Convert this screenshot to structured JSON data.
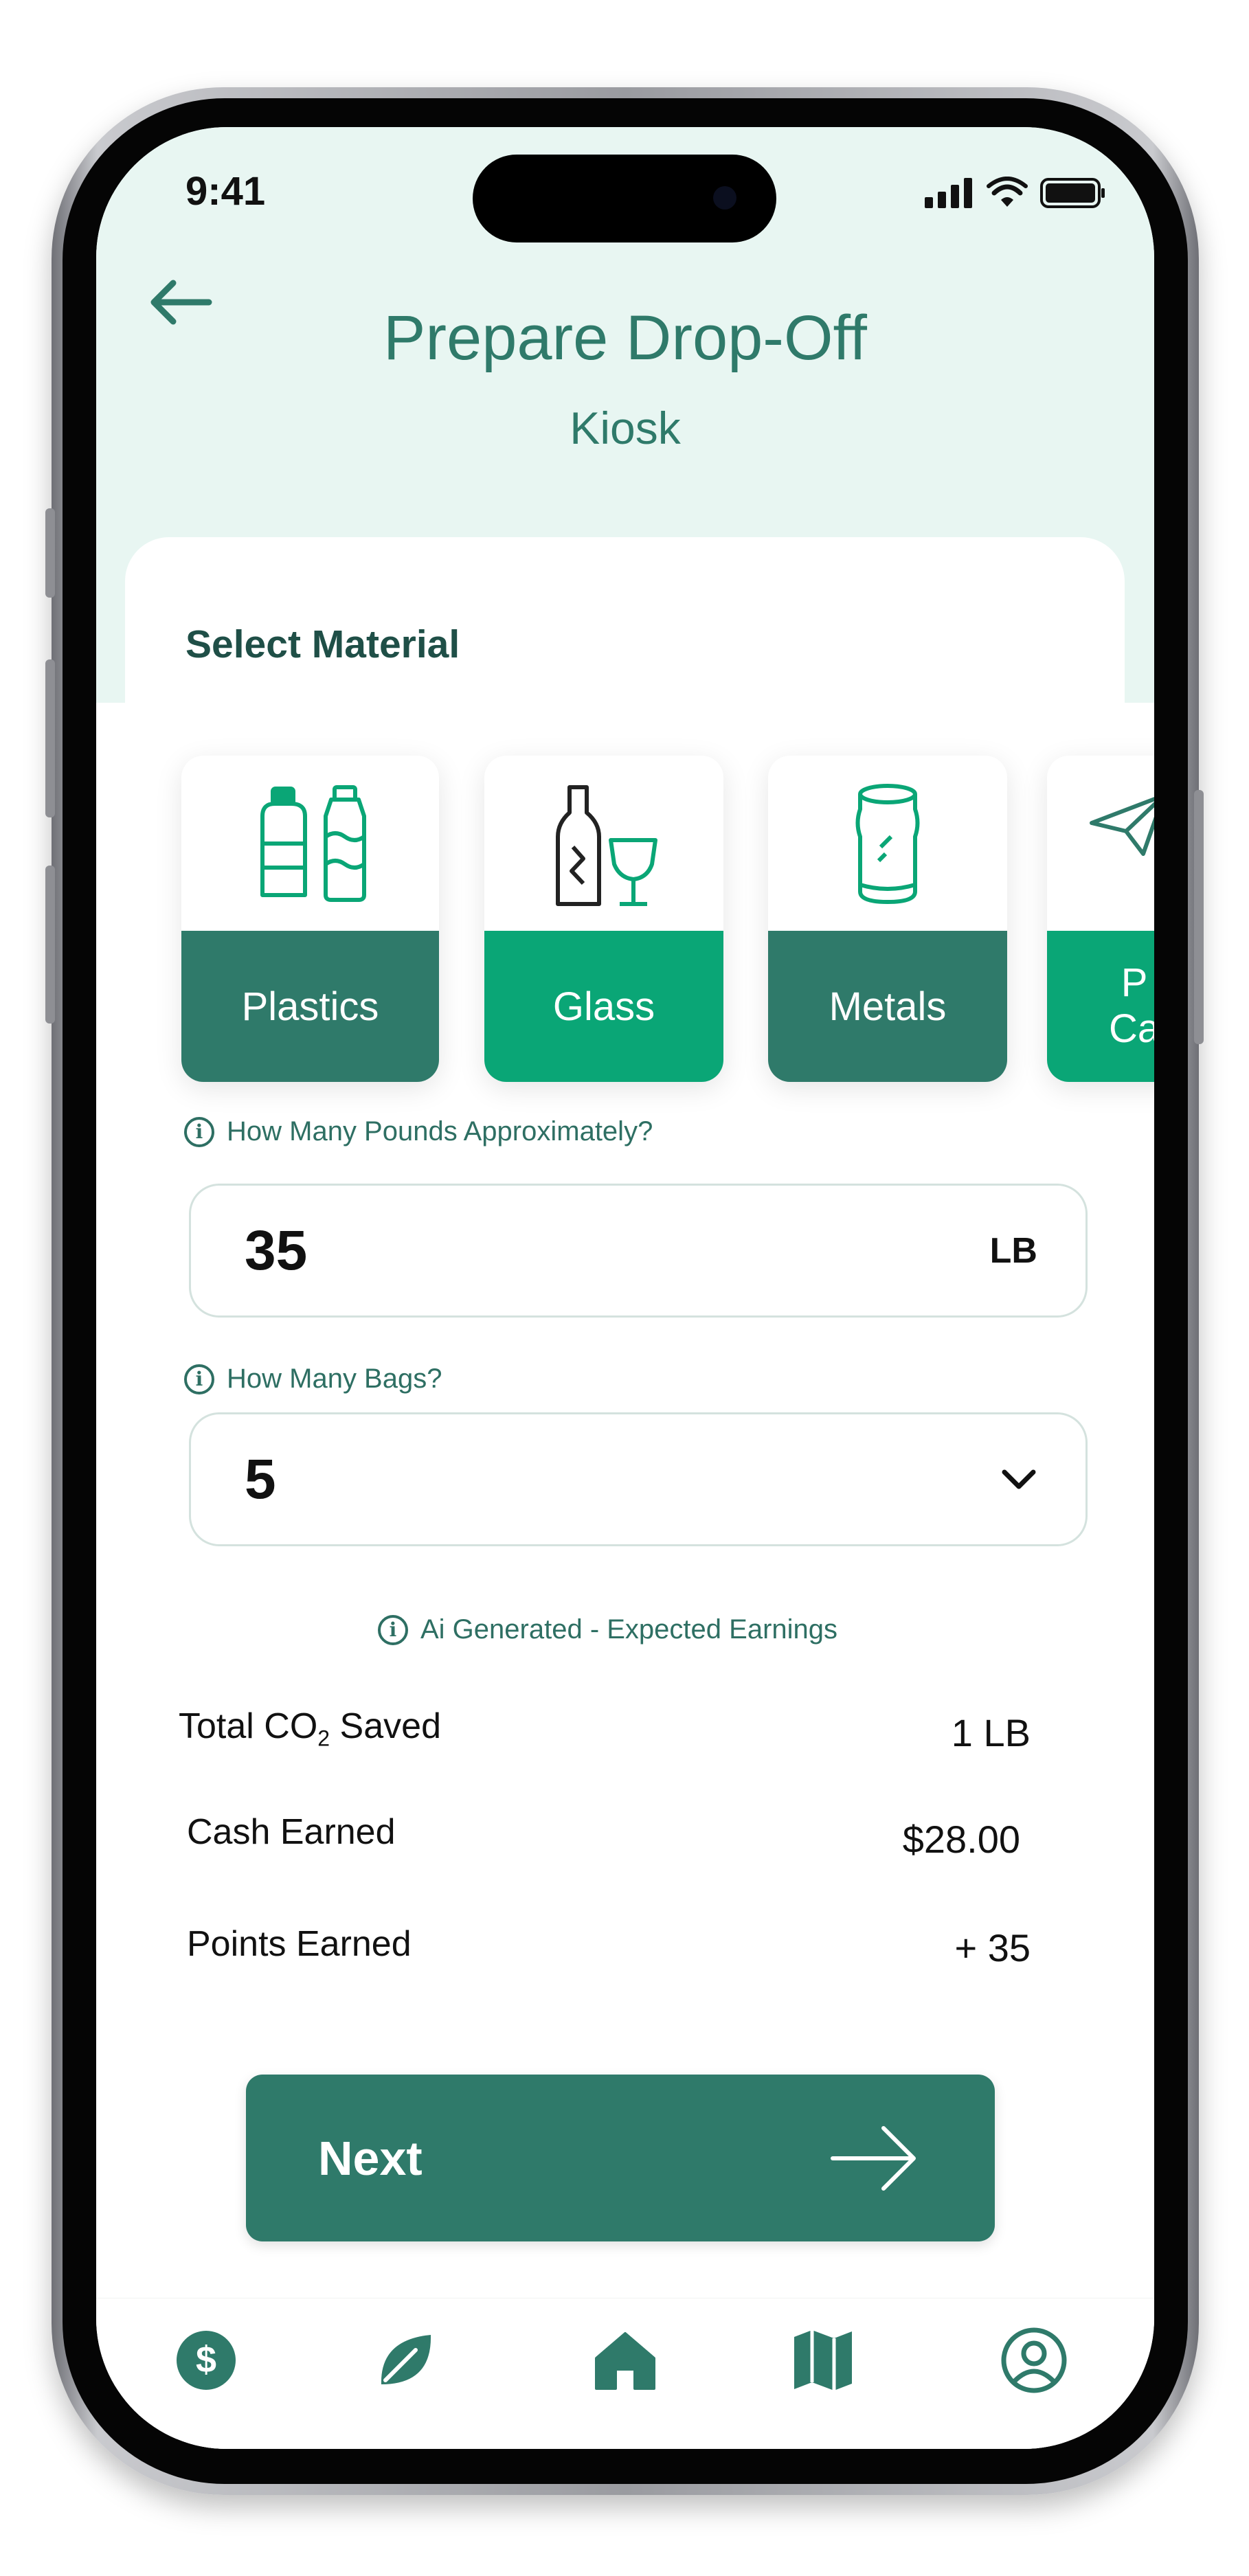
{
  "status_bar": {
    "time": "9:41"
  },
  "header": {
    "title": "Prepare Drop-Off",
    "subtitle": "Kiosk"
  },
  "section": {
    "label": "Select Material"
  },
  "materials": [
    {
      "label": "Plastics",
      "selected": true
    },
    {
      "label": "Glass",
      "selected": false
    },
    {
      "label": "Metals",
      "selected": false
    },
    {
      "label": "P\nCa",
      "selected": false
    }
  ],
  "pounds": {
    "hint": "How Many Pounds Approximately?",
    "value": "35",
    "unit": "LB"
  },
  "bags": {
    "hint": "How Many Bags?",
    "value": "5"
  },
  "earnings": {
    "hint": "Ai Generated - Expected Earnings",
    "co2_label_prefix": "Total CO",
    "co2_label_sub": "2",
    "co2_label_suffix": " Saved",
    "co2_value": "1 LB",
    "cash_label": "Cash Earned",
    "cash_value": "$28.00",
    "points_label": "Points Earned",
    "points_value": "+ 35"
  },
  "next_button": {
    "label": "Next"
  },
  "colors": {
    "primary": "#2f7a6a",
    "bright": "#0aa676",
    "header_bg": "#e8f6f2"
  },
  "tab_icons": [
    "dollar-icon",
    "leaf-icon",
    "home-icon",
    "map-icon",
    "profile-icon"
  ]
}
